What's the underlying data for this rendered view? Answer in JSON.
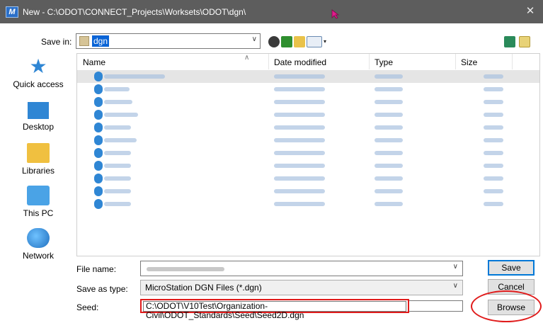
{
  "window": {
    "title": "New - C:\\ODOT\\CONNECT_Projects\\Worksets\\ODOT\\dgn\\",
    "close_glyph": "✕",
    "app_icon_glyph": "M"
  },
  "toolbar": {
    "save_in_label": "Save in:",
    "save_in_value": "dgn"
  },
  "places": {
    "items": [
      {
        "label": "Quick access",
        "icon": "star-icon"
      },
      {
        "label": "Desktop",
        "icon": "desktop-icon"
      },
      {
        "label": "Libraries",
        "icon": "libraries-icon"
      },
      {
        "label": "This PC",
        "icon": "computer-icon"
      },
      {
        "label": "Network",
        "icon": "network-icon"
      }
    ]
  },
  "file_list": {
    "columns": [
      "Name",
      "Date modified",
      "Type",
      "Size"
    ],
    "rows": [
      {
        "selected": true
      },
      {
        "selected": false
      },
      {
        "selected": false
      },
      {
        "selected": false
      },
      {
        "selected": false
      },
      {
        "selected": false
      },
      {
        "selected": false
      },
      {
        "selected": false
      },
      {
        "selected": false
      },
      {
        "selected": false
      },
      {
        "selected": false
      }
    ]
  },
  "form": {
    "file_name_label": "File name:",
    "file_name_value": "",
    "save_as_type_label": "Save as type:",
    "save_as_type_value": "MicroStation DGN Files (*.dgn)",
    "seed_label": "Seed:",
    "seed_value": "C:\\ODOT\\V10Test\\Organization-Civil\\ODOT_Standards\\Seed\\Seed2D.dgn"
  },
  "buttons": {
    "save": "Save",
    "cancel": "Cancel",
    "browse": "Browse"
  },
  "colors": {
    "title_bar": "#5d5d5d",
    "selection": "#0a64d6",
    "highlight_annotation": "#e01b1b"
  }
}
